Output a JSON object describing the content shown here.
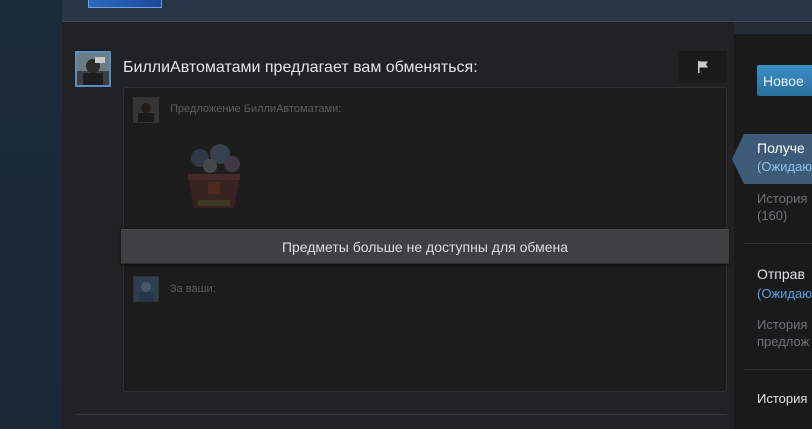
{
  "offer": {
    "title": "БиллиАвтоматами предлагает вам обменяться:",
    "their_label": "Предложение БиллиАвтоматами:",
    "unavailable_message": "Предметы больше не доступны для обмена",
    "your_label": "За ваши:"
  },
  "sidebar": {
    "new_offer_label": "Новое",
    "received_title": "Получе",
    "received_status": "(Ожидаю",
    "received_history_line1": "История",
    "received_history_line2": "(160)",
    "sent_title": "Отправ",
    "sent_status": "(Ожидаю",
    "sent_history_line1": "История",
    "sent_history_line2": "предлож",
    "history_label": "История"
  },
  "icons": {
    "flag": "flag-icon"
  },
  "colors": {
    "accent_blue": "#3a8fc7",
    "status_blue": "#6aa6d8",
    "selected_tab": "#3d5a78"
  }
}
